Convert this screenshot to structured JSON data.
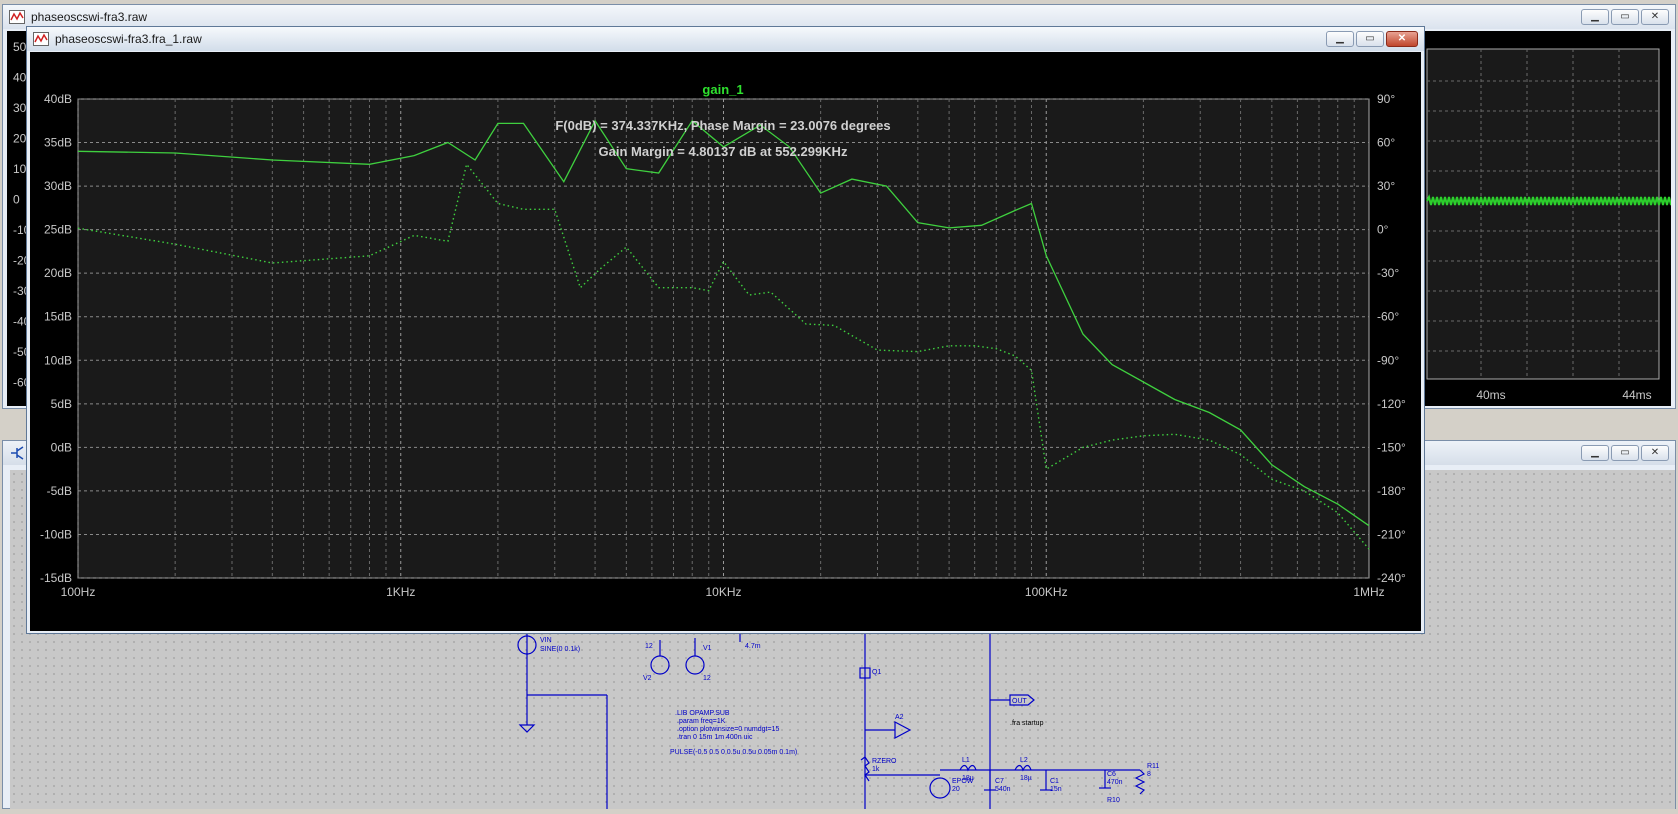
{
  "back_window": {
    "title": "phaseoscswi-fra3.raw",
    "y_ticks": [
      "50",
      "40",
      "30",
      "20",
      "10",
      "0",
      "-10",
      "-20",
      "-30",
      "-40",
      "-50",
      "-60"
    ],
    "x_ticks": [
      "40ms",
      "44ms"
    ]
  },
  "front_window": {
    "title": "phaseoscswi-fra3.fra_1.raw",
    "trace_label": "gain_1",
    "annotation_line1": "F(0dB) = 374.337KHz, Phase Margin = 23.0076 degrees",
    "annotation_line2": "Gain Margin = 4.80137 dB at 552.299KHz"
  },
  "buttons": {
    "minimize": "▁",
    "maximize": "▭",
    "close": "✕"
  },
  "colors": {
    "trace": "#3fd03f",
    "grid": "#9a9a9a",
    "axis_text": "#c8c8c8",
    "plot_bg": "#1a1a1a",
    "schematic_wire": "#0000c8"
  },
  "schematic": {
    "labels": [
      "VIN",
      "SINE(0 0.1k)",
      "12",
      "V2",
      "V1",
      "12",
      "4.7m",
      ".LIB OPAMP.SUB",
      ".param freq=1K",
      ".option plotwinsize=0 numdgt=15",
      ".tran 0 15m 1m 400n uic",
      "PULSE(-0.5 0.5 0 0.5u 0.5u 0.05m 0.1m)",
      "Q1",
      "A2",
      "RZERO",
      "1k",
      "EPOW",
      "20",
      "C7",
      "540n",
      "L1",
      "18µ",
      "L2",
      "18µ",
      "C1",
      "15n",
      "C6",
      "470n",
      "R10",
      "R11",
      "8",
      "OUT",
      ".fra startup"
    ]
  },
  "chart_data": {
    "type": "line",
    "title": "gain_1",
    "x_scale": "log",
    "xlim": [
      100,
      1000000
    ],
    "x_ticks": [
      "100Hz",
      "1KHz",
      "10KHz",
      "100KHz",
      "1MHz"
    ],
    "ylim": [
      -15,
      40
    ],
    "y_ticks": [
      "40dB",
      "35dB",
      "30dB",
      "25dB",
      "20dB",
      "15dB",
      "10dB",
      "5dB",
      "0dB",
      "-5dB",
      "-10dB",
      "-15dB"
    ],
    "y2lim": [
      -240,
      90
    ],
    "y2_ticks": [
      "90°",
      "60°",
      "30°",
      "0°",
      "-30°",
      "-60°",
      "-90°",
      "-120°",
      "-150°",
      "-180°",
      "-210°",
      "-240°"
    ],
    "series": [
      {
        "style": "solid",
        "axis": "left",
        "x": [
          100,
          200,
          400,
          800,
          1100,
          1400,
          1700,
          2000,
          2400,
          3200,
          4000,
          5000,
          6300,
          8000,
          10000,
          13000,
          16000,
          20000,
          25000,
          32000,
          40000,
          50000,
          63000,
          80000,
          90000,
          100000,
          130000,
          160000,
          200000,
          250000,
          320000,
          400000,
          500000,
          630000,
          800000,
          1000000
        ],
        "y": [
          34,
          33.8,
          33,
          32.5,
          33.5,
          35,
          33,
          37.2,
          37.2,
          30.5,
          37.5,
          32,
          31.5,
          37.5,
          34.5,
          37,
          34.5,
          29.2,
          30.8,
          30,
          25.8,
          25.2,
          25.5,
          27.2,
          28,
          22,
          13,
          9.5,
          7.5,
          5.5,
          4,
          2,
          -2,
          -4.5,
          -6.5,
          -9
        ]
      },
      {
        "style": "dotted",
        "axis": "right",
        "x": [
          100,
          200,
          400,
          800,
          1100,
          1400,
          1600,
          2000,
          2400,
          3000,
          3600,
          4200,
          5000,
          6300,
          8000,
          9000,
          10000,
          12000,
          14000,
          18000,
          22000,
          30000,
          40000,
          50000,
          60000,
          70000,
          80000,
          90000,
          100000,
          130000,
          160000,
          200000,
          250000,
          320000,
          400000,
          500000,
          630000,
          800000,
          1000000
        ],
        "y": [
          1,
          -10,
          -23,
          -18,
          -4,
          -8,
          45,
          18,
          14,
          14,
          -40,
          -26,
          -12,
          -40,
          -40,
          -42,
          -22,
          -45,
          -43,
          -65,
          -66,
          -83,
          -84,
          -80,
          -80,
          -82,
          -87,
          -97,
          -165,
          -150,
          -145,
          -142,
          -141,
          -145,
          -155,
          -172,
          -180,
          -195,
          -220
        ]
      }
    ]
  }
}
